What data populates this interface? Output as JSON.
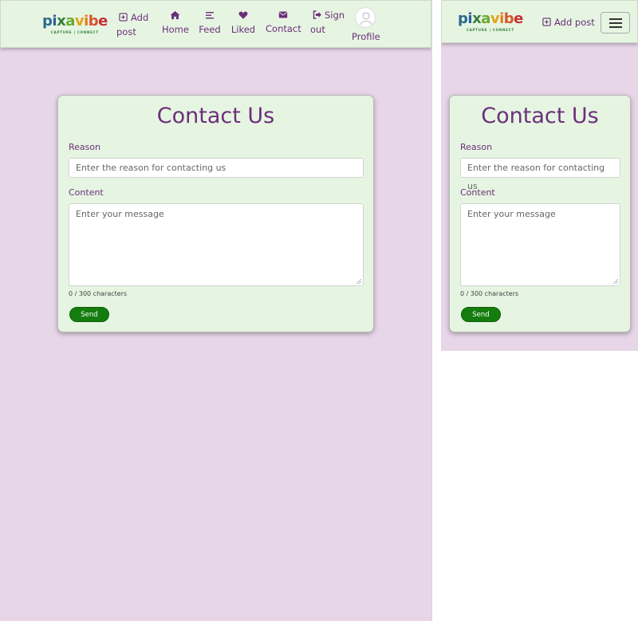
{
  "brand": {
    "name": "pixavibe",
    "tagline": "CAPTURE | CONNECT",
    "colors": {
      "text": "#6b2f7a",
      "nav_bg": "#e6f5e2",
      "page_bg": "#e7d5e8",
      "send_bg": "#147d0e"
    }
  },
  "nav": {
    "add_post": "Add post",
    "add_post_line1": "Add",
    "add_post_line2": "post",
    "home": "Home",
    "feed": "Feed",
    "liked": "Liked",
    "contact": "Contact",
    "sign_out_line1": "Sign",
    "sign_out_line2": "out",
    "profile": "Profile",
    "icons": {
      "add_post": "plus-square-icon",
      "home": "home-icon",
      "feed": "bars-icon",
      "liked": "heart-icon",
      "contact": "envelope-icon",
      "sign_out": "sign-out-icon",
      "menu": "hamburger-icon"
    }
  },
  "contact_form": {
    "title": "Contact Us",
    "reason_label": "Reason",
    "reason_placeholder": "Enter the reason for contacting us",
    "content_label": "Content",
    "content_placeholder": "Enter your message",
    "counter": "0 / 300 characters",
    "send_label": "Send"
  }
}
